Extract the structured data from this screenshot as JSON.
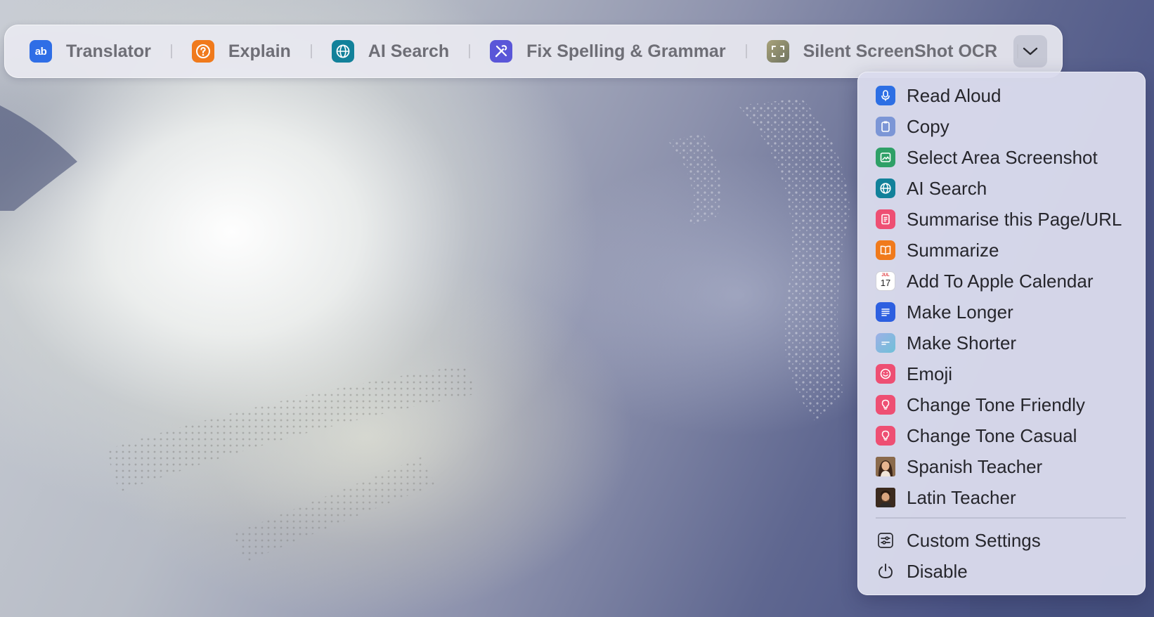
{
  "toolbar": {
    "items": [
      {
        "label": "Translator",
        "icon": "translator-ab-icon",
        "color": "#2f6ee6"
      },
      {
        "label": "Explain",
        "icon": "question-circle-icon",
        "color": "#f07a1c"
      },
      {
        "label": "AI Search",
        "icon": "globe-icon",
        "color": "#12819a"
      },
      {
        "label": "Fix Spelling & Grammar",
        "icon": "tools-icon",
        "color": "#5a56d8"
      },
      {
        "label": "Silent ScreenShot OCR",
        "icon": "screenshot-frame-icon",
        "color": "#8a8a66"
      }
    ],
    "more_icon": "chevron-down-icon"
  },
  "menu": {
    "items": [
      {
        "label": "Read Aloud",
        "icon": "microphone-icon",
        "color": "#2d6fe4"
      },
      {
        "label": "Copy",
        "icon": "clipboard-icon",
        "color": "#6f8fd8"
      },
      {
        "label": "Select Area Screenshot",
        "icon": "image-icon",
        "color": "#2fa067"
      },
      {
        "label": "AI Search",
        "icon": "globe-icon",
        "color": "#12819a"
      },
      {
        "label": "Summarise this Page/URL",
        "icon": "document-icon",
        "color": "#ee4f73"
      },
      {
        "label": "Summarize",
        "icon": "book-icon",
        "color": "#f07a1c"
      },
      {
        "label": "Add To Apple Calendar",
        "icon": "calendar-icon",
        "color": "#ffffff",
        "calendar_month": "JUL",
        "calendar_day": "17"
      },
      {
        "label": "Make Longer",
        "icon": "lines-long-icon",
        "color": "#2d5fe0"
      },
      {
        "label": "Make Shorter",
        "icon": "lines-short-icon",
        "color": "#8a9ad8"
      },
      {
        "label": "Emoji",
        "icon": "smiley-icon",
        "color": "#ee4f73"
      },
      {
        "label": "Change Tone Friendly",
        "icon": "lightbulb-icon",
        "color": "#ee4f73"
      },
      {
        "label": "Change Tone Casual",
        "icon": "lightbulb-icon",
        "color": "#ee4f73"
      },
      {
        "label": "Spanish Teacher",
        "icon": "avatar-woman-icon",
        "color": "#7a5a40"
      },
      {
        "label": "Latin Teacher",
        "icon": "avatar-man-icon",
        "color": "#5a4030"
      }
    ],
    "footer": [
      {
        "label": "Custom Settings",
        "icon": "sliders-icon"
      },
      {
        "label": "Disable",
        "icon": "power-icon"
      }
    ]
  }
}
